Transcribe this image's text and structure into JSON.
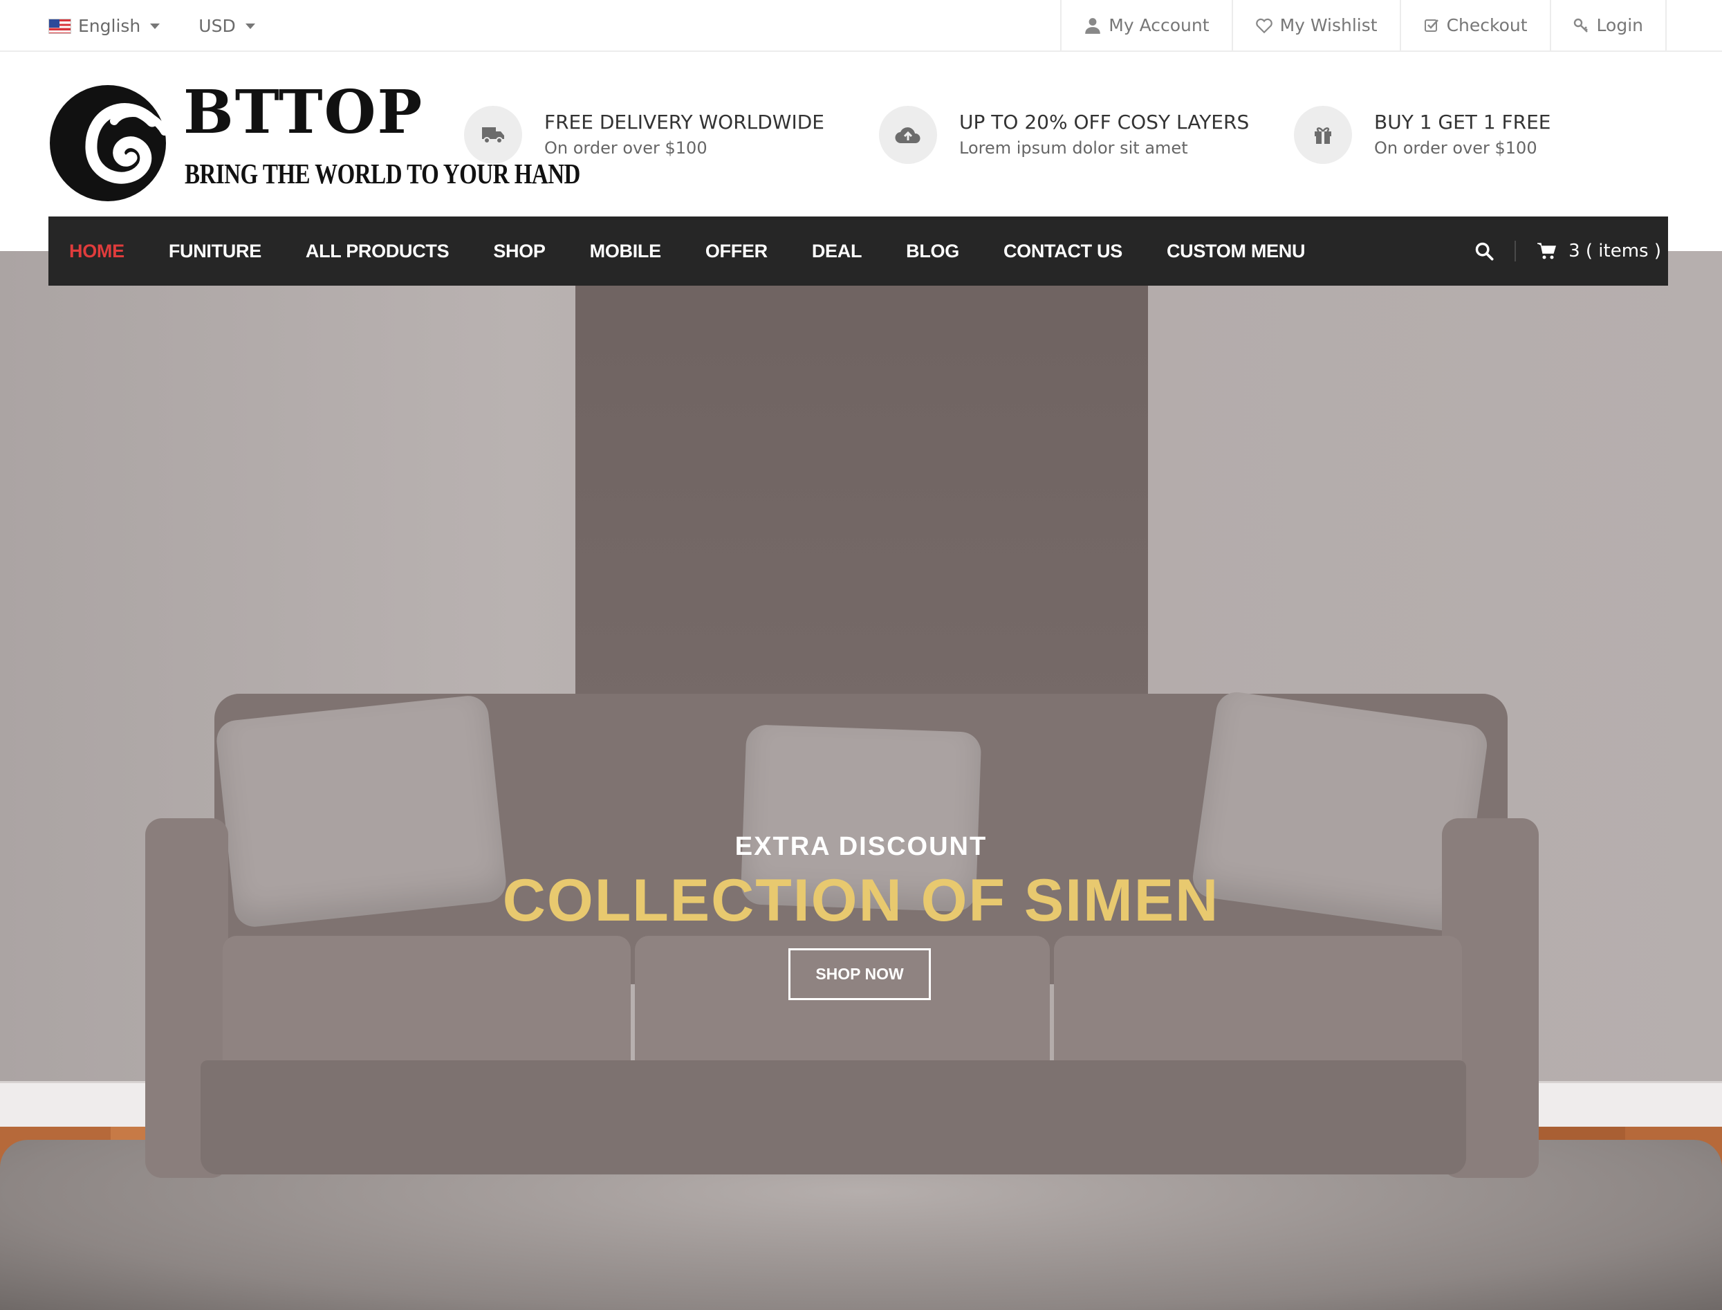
{
  "topbar": {
    "language": "English",
    "currency": "USD",
    "links": [
      {
        "label": "My Account"
      },
      {
        "label": "My Wishlist"
      },
      {
        "label": "Checkout"
      },
      {
        "label": "Login"
      }
    ]
  },
  "header": {
    "logo_word": "BTTOP",
    "logo_tagline": "BRING THE WORLD TO YOUR HAND",
    "features": [
      {
        "title": "FREE DELIVERY WORLDWIDE",
        "subtitle": "On order over $100",
        "icon": "truck-icon"
      },
      {
        "title": "UP TO 20% OFF COSY LAYERS",
        "subtitle": "Lorem ipsum dolor sit amet",
        "icon": "cloud-upload-icon"
      },
      {
        "title": "BUY 1 GET 1 FREE",
        "subtitle": "On order over $100",
        "icon": "gift-icon"
      }
    ]
  },
  "nav": {
    "items": [
      {
        "label": "HOME"
      },
      {
        "label": "FUNITURE"
      },
      {
        "label": "ALL PRODUCTS"
      },
      {
        "label": "SHOP"
      },
      {
        "label": "MOBILE"
      },
      {
        "label": "OFFER"
      },
      {
        "label": "DEAL"
      },
      {
        "label": "BLOG"
      },
      {
        "label": "CONTACT US"
      },
      {
        "label": "CUSTOM MENU"
      }
    ],
    "active_color": "#e03c3c",
    "cart_label": "3 ( items )"
  },
  "hero": {
    "subtitle": "EXTRA DISCOUNT",
    "title": "COLLECTION OF SIMEN",
    "button_label": "SHOP NOW",
    "title_color": "#e8c96f"
  }
}
